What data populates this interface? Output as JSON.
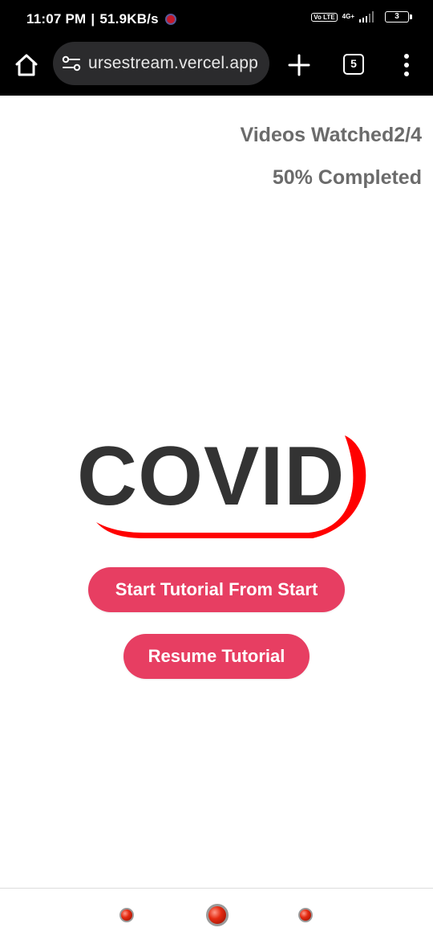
{
  "status_bar": {
    "time": "11:07 PM",
    "separator": "|",
    "speed": "51.9KB/s",
    "volte": "Vo LTE",
    "network": "4G+",
    "battery": "3"
  },
  "browser": {
    "url": "ursestream.vercel.app",
    "tab_count": "5",
    "icons": [
      "home-icon",
      "site-settings-icon",
      "plus-icon",
      "tab-switcher-icon",
      "more-vert-icon"
    ]
  },
  "progress": {
    "videos_label": "Videos Watched",
    "videos_value": "2/4",
    "completed_text": "50% Completed"
  },
  "logo": {
    "text": "COVID",
    "text_color": "#333333",
    "accent_color": "#ff0000"
  },
  "actions": {
    "start_label": "Start Tutorial From Start",
    "resume_label": "Resume Tutorial",
    "button_color": "#e73e62"
  }
}
